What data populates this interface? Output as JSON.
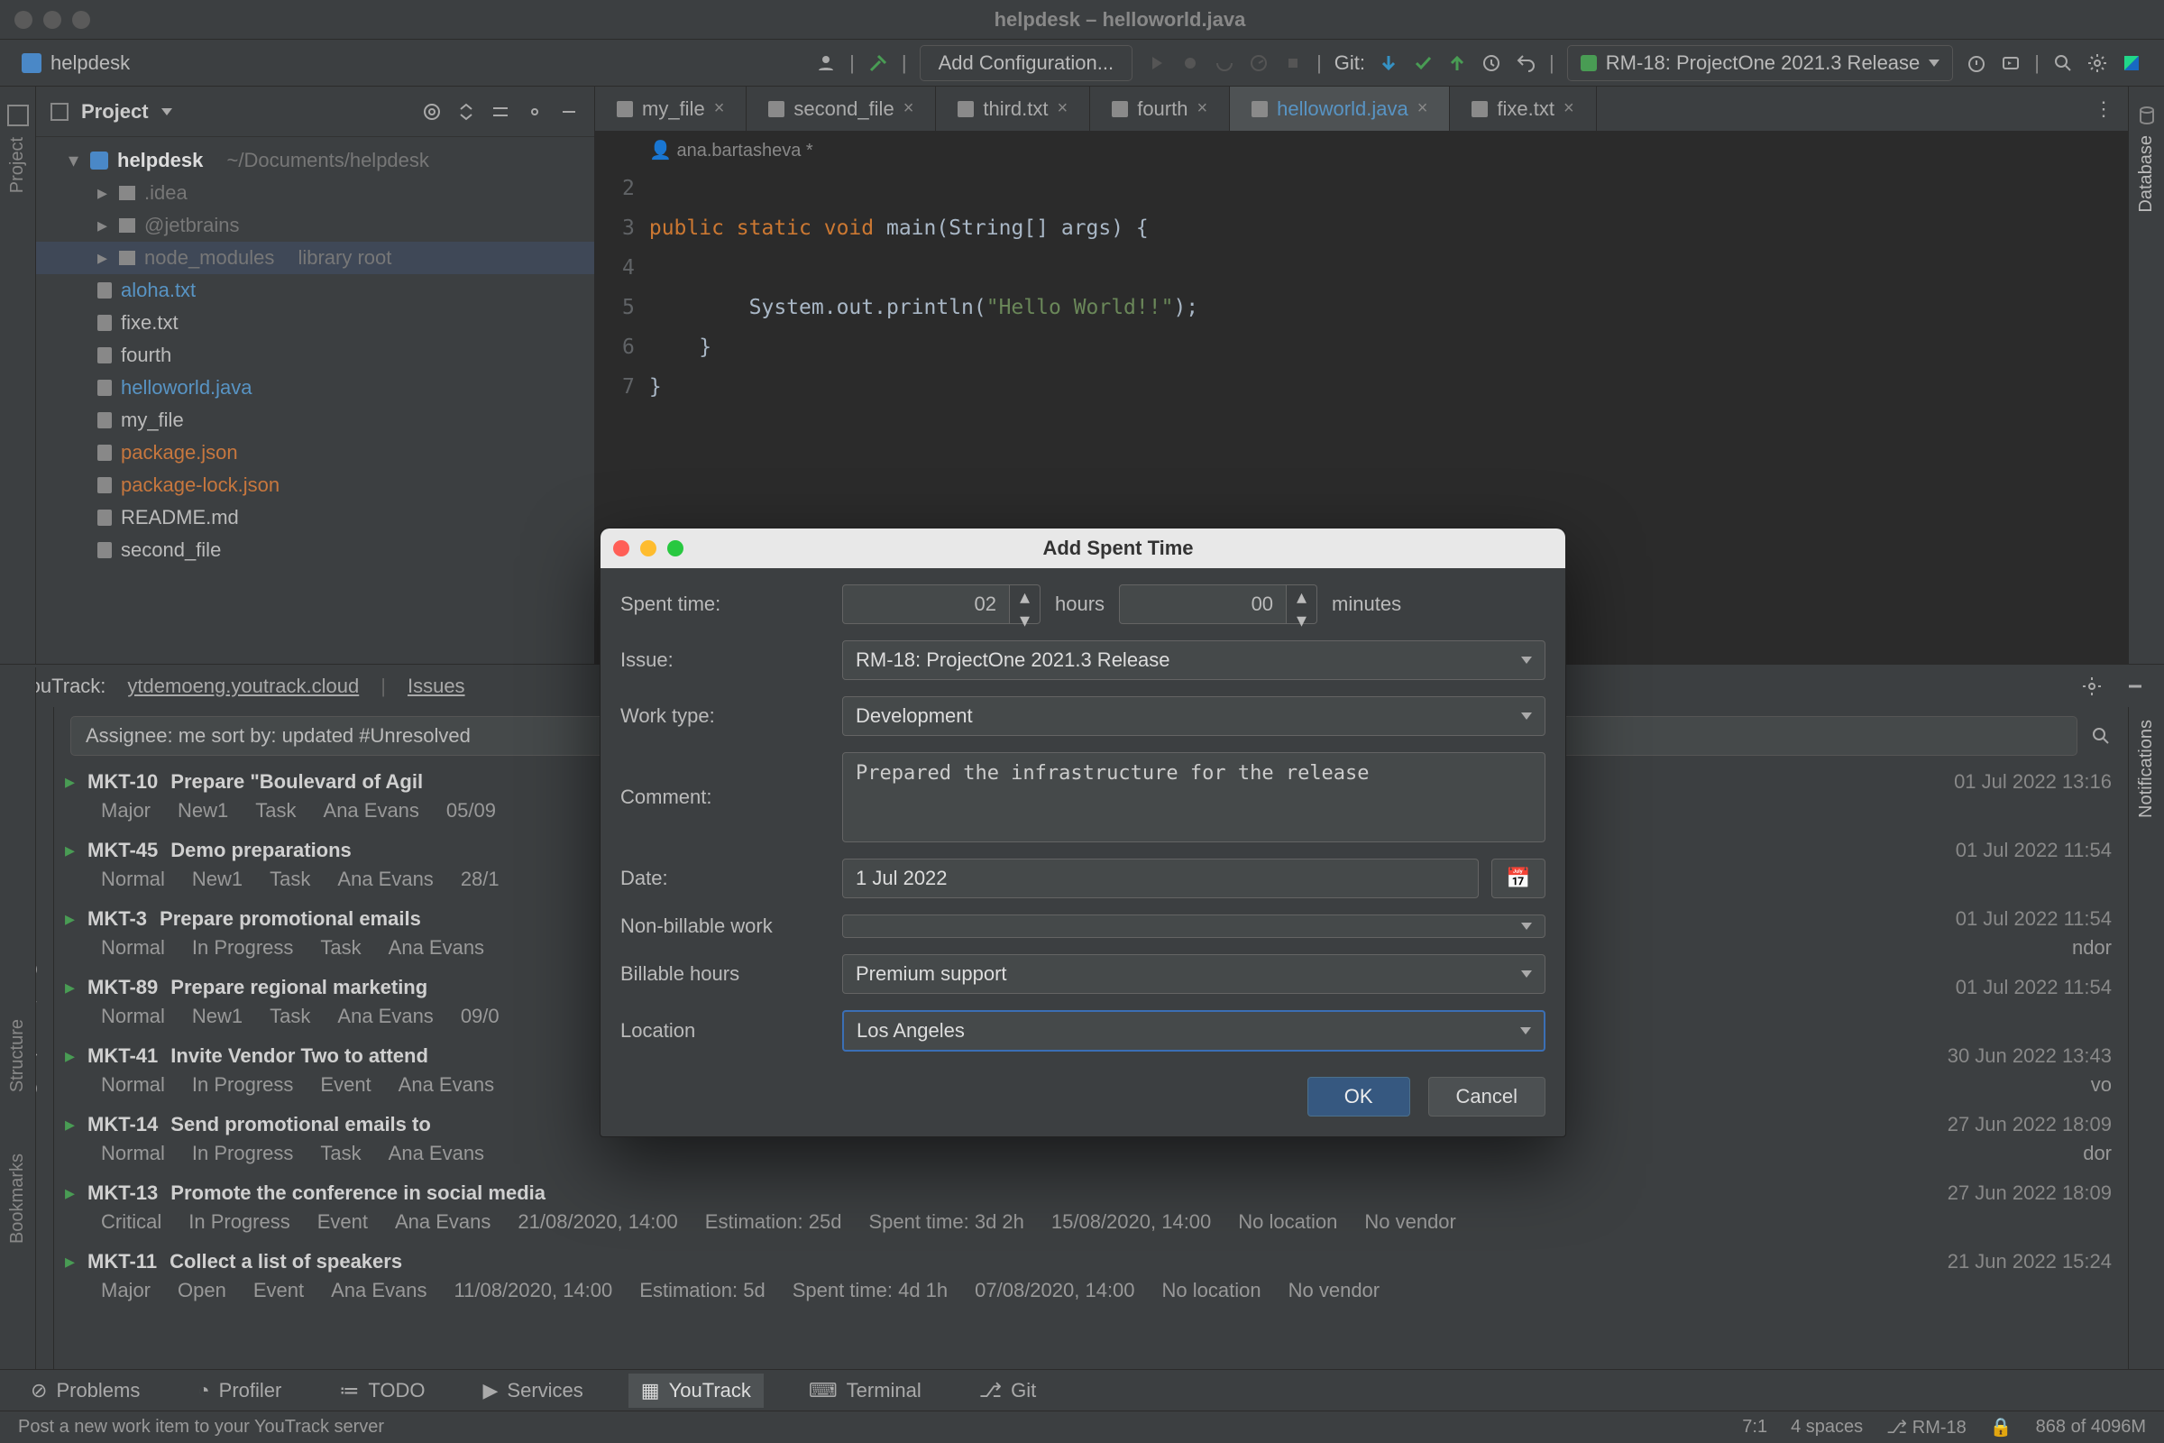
{
  "window": {
    "title": "helpdesk – helloworld.java"
  },
  "toolbar": {
    "project": "helpdesk",
    "add_config": "Add Configuration...",
    "git_label": "Git:",
    "run_config": "RM-18: ProjectOne 2021.3 Release"
  },
  "project_pane": {
    "title": "Project",
    "root": "helpdesk",
    "root_path": "~/Documents/helpdesk",
    "nodes": [
      {
        "label": ".idea",
        "cls": "muted"
      },
      {
        "label": "@jetbrains",
        "cls": "muted"
      },
      {
        "label": "node_modules",
        "hint": "library root",
        "cls": "muted",
        "sel": true
      },
      {
        "label": "aloha.txt",
        "cls": "link",
        "leaf": true
      },
      {
        "label": "fixe.txt",
        "cls": "file",
        "leaf": true
      },
      {
        "label": "fourth",
        "cls": "file",
        "leaf": true
      },
      {
        "label": "helloworld.java",
        "cls": "link",
        "leaf": true
      },
      {
        "label": "my_file",
        "cls": "file",
        "leaf": true
      },
      {
        "label": "package.json",
        "cls": "warn",
        "leaf": true
      },
      {
        "label": "package-lock.json",
        "cls": "warn",
        "leaf": true
      },
      {
        "label": "README.md",
        "cls": "file",
        "leaf": true
      },
      {
        "label": "second_file",
        "cls": "file",
        "leaf": true
      }
    ]
  },
  "tabs": [
    {
      "label": "my_file"
    },
    {
      "label": "second_file"
    },
    {
      "label": "third.txt"
    },
    {
      "label": "fourth"
    },
    {
      "label": "helloworld.java",
      "active": true
    },
    {
      "label": "fixe.txt"
    }
  ],
  "breadcrumb_author": "ana.bartasheva *",
  "code": {
    "lines": [
      "2",
      "3",
      "4",
      "5",
      "6",
      "7"
    ],
    "l2a": "public ",
    "l2b": "static ",
    "l2c": "void ",
    "l2d": "main(String[] args) {",
    "l4a": "        System.out.println(",
    "l4b": "\"Hello World!!\"",
    "l4c": ");",
    "l5": "    }",
    "l6": "}"
  },
  "youtrack_bar": {
    "title": "YouTrack:",
    "server": "ytdemoeng.youtrack.cloud",
    "tab": "Issues"
  },
  "search_query": "Assignee: me sort by: updated #Unresolved",
  "issues": [
    {
      "id": "MKT-10",
      "title": "Prepare \"Boulevard of Agil",
      "date": "01 Jul 2022 13:16",
      "meta": [
        "Major",
        "New1",
        "Task",
        "Ana Evans",
        "05/09"
      ]
    },
    {
      "id": "MKT-45",
      "title": "Demo preparations",
      "date": "01 Jul 2022 11:54",
      "meta": [
        "Normal",
        "New1",
        "Task",
        "Ana Evans",
        "28/1"
      ]
    },
    {
      "id": "MKT-3",
      "title": "Prepare promotional emails",
      "date": "01 Jul 2022 11:54",
      "meta": [
        "Normal",
        "In Progress",
        "Task",
        "Ana Evans"
      ],
      "tail": "ndor"
    },
    {
      "id": "MKT-89",
      "title": "Prepare regional marketing",
      "date": "01 Jul 2022 11:54",
      "meta": [
        "Normal",
        "New1",
        "Task",
        "Ana Evans",
        "09/0"
      ]
    },
    {
      "id": "MKT-41",
      "title": "Invite Vendor Two to attend",
      "date": "30 Jun 2022 13:43",
      "meta": [
        "Normal",
        "In Progress",
        "Event",
        "Ana Evans"
      ],
      "tail": "vo"
    },
    {
      "id": "MKT-14",
      "title": "Send promotional emails to",
      "date": "27 Jun 2022 18:09",
      "meta": [
        "Normal",
        "In Progress",
        "Task",
        "Ana Evans"
      ],
      "tail": "dor"
    },
    {
      "id": "MKT-13",
      "title": "Promote the conference in social media",
      "date": "27 Jun 2022 18:09",
      "meta": [
        "Critical",
        "In Progress",
        "Event",
        "Ana Evans",
        "21/08/2020, 14:00",
        "Estimation: 25d",
        "Spent time: 3d 2h",
        "15/08/2020, 14:00",
        "No location",
        "No vendor"
      ]
    },
    {
      "id": "MKT-11",
      "title": "Collect a list of speakers",
      "date": "21 Jun 2022 15:24",
      "meta": [
        "Major",
        "Open",
        "Event",
        "Ana Evans",
        "11/08/2020, 14:00",
        "Estimation: 5d",
        "Spent time: 4d 1h",
        "07/08/2020, 14:00",
        "No location",
        "No vendor"
      ]
    }
  ],
  "bottom_tools": [
    {
      "label": "Problems"
    },
    {
      "label": "Profiler"
    },
    {
      "label": "TODO"
    },
    {
      "label": "Services"
    },
    {
      "label": "YouTrack",
      "active": true
    },
    {
      "label": "Terminal"
    },
    {
      "label": "Git"
    }
  ],
  "status": {
    "msg": "Post a new work item to your YouTrack server",
    "pos": "7:1",
    "indent": "4 spaces",
    "branch": "RM-18",
    "mem": "868 of 4096M"
  },
  "dialog": {
    "title": "Add Spent Time",
    "labels": {
      "spent": "Spent time:",
      "hours": "hours",
      "minutes": "minutes",
      "issue": "Issue:",
      "worktype": "Work type:",
      "comment": "Comment:",
      "date": "Date:",
      "nonbill": "Non-billable work",
      "bill": "Billable hours",
      "loc": "Location"
    },
    "values": {
      "hours": "02",
      "minutes": "00",
      "issue": "RM-18: ProjectOne 2021.3 Release",
      "worktype": "Development",
      "comment": "Prepared the infrastructure for the release",
      "date": "1 Jul 2022",
      "bill": "Premium support",
      "loc": "Los Angeles"
    },
    "buttons": {
      "ok": "OK",
      "cancel": "Cancel"
    }
  },
  "right_tools": {
    "database": "Database",
    "notifications": "Notifications"
  },
  "left_tools": {
    "project": "Project",
    "structure": "Structure",
    "bookmarks": "Bookmarks"
  }
}
